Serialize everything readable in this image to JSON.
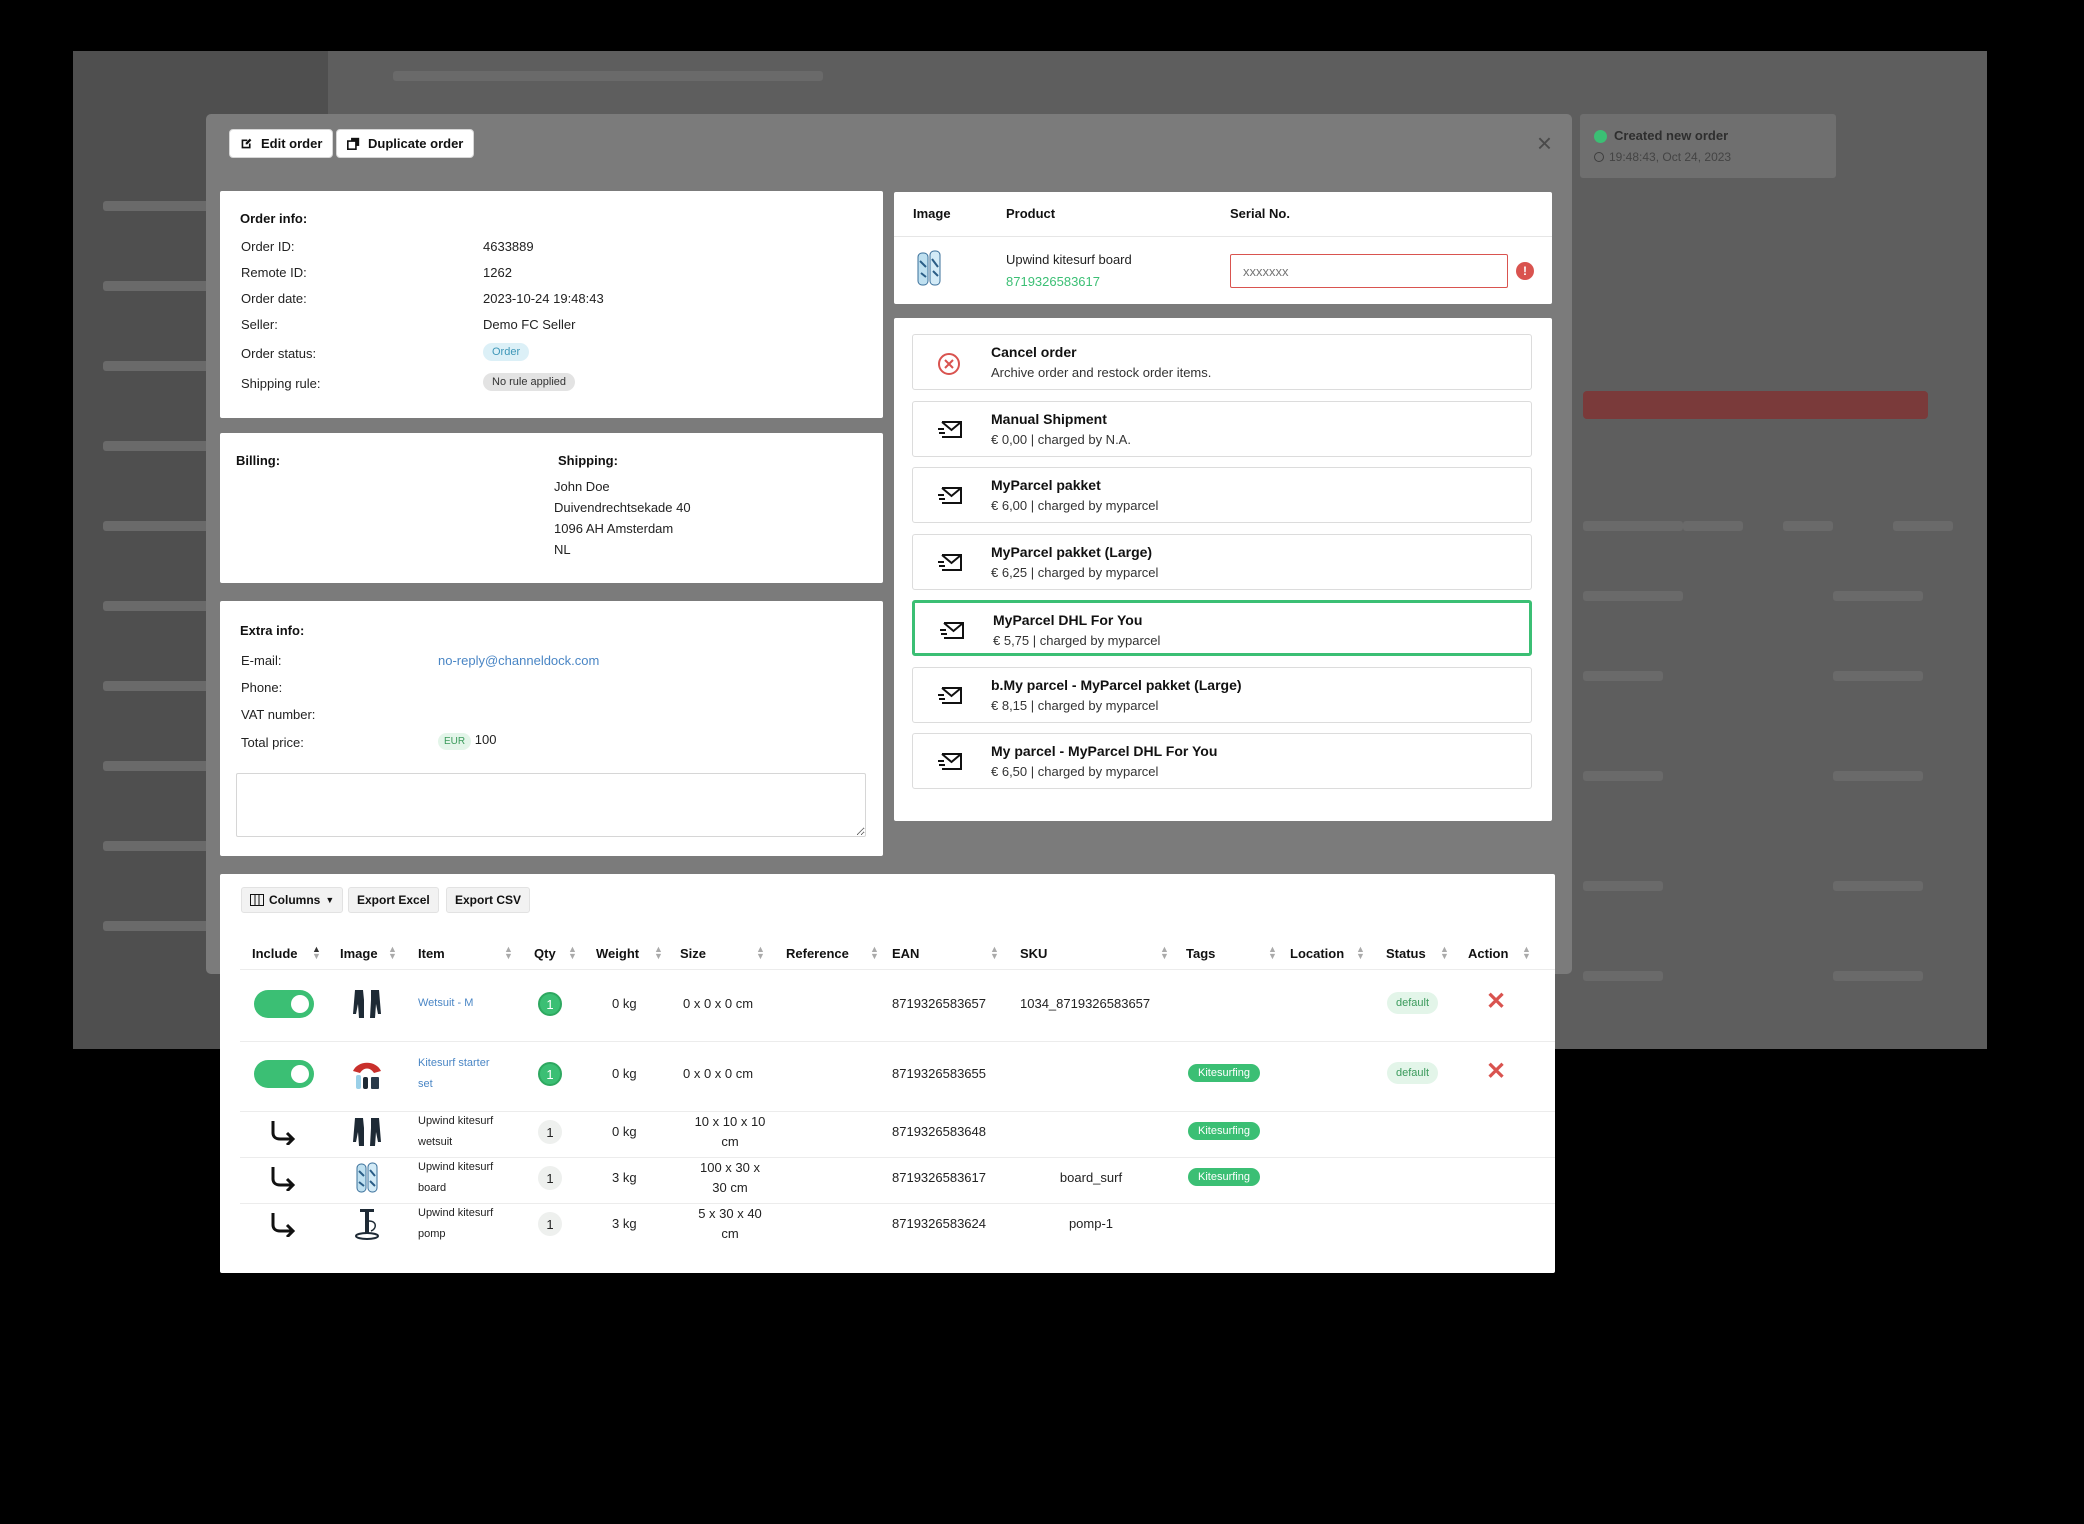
{
  "modal": {
    "edit_label": "Edit order",
    "duplicate_label": "Duplicate order",
    "close": "×"
  },
  "toast": {
    "title": "Created new order",
    "time": "19:48:43, Oct 24, 2023"
  },
  "order_info": {
    "heading": "Order info:",
    "rows": [
      {
        "label": "Order ID:",
        "value": "4633889"
      },
      {
        "label": "Remote ID:",
        "value": "1262"
      },
      {
        "label": "Order date:",
        "value": "2023-10-24 19:48:43"
      },
      {
        "label": "Seller:",
        "value": "Demo FC Seller"
      }
    ],
    "status_label": "Order status:",
    "status_badge": "Order",
    "rule_label": "Shipping rule:",
    "rule_badge": "No rule applied"
  },
  "address": {
    "billing_heading": "Billing:",
    "shipping_heading": "Shipping:",
    "shipping_lines": [
      "John Doe",
      "Duivendrechtsekade 40",
      "1096 AH Amsterdam",
      "NL"
    ]
  },
  "extra_info": {
    "heading": "Extra info:",
    "email_label": "E-mail:",
    "email": "no-reply@channeldock.com",
    "phone_label": "Phone:",
    "vat_label": "VAT number:",
    "total_label": "Total price:",
    "currency": "EUR",
    "total": "100"
  },
  "serial_table": {
    "headers": [
      "Image",
      "Product",
      "Serial No."
    ],
    "product_name": "Upwind kitesurf board",
    "product_ean": "8719326583617",
    "serial_placeholder": "xxxxxxx"
  },
  "shipping_options": [
    {
      "title": "Cancel order",
      "sub": "Archive order and restock order items.",
      "icon": "cancel-circle-icon",
      "selected": false
    },
    {
      "title": "Manual Shipment",
      "sub": "€ 0,00 | charged by N.A.",
      "icon": "envelope-icon",
      "selected": false
    },
    {
      "title": "MyParcel pakket",
      "sub": "€ 6,00 | charged by myparcel",
      "icon": "envelope-icon",
      "selected": false
    },
    {
      "title": "MyParcel pakket (Large)",
      "sub": "€ 6,25 | charged by myparcel",
      "icon": "envelope-icon",
      "selected": false
    },
    {
      "title": "MyParcel DHL For You",
      "sub": "€ 5,75 | charged by myparcel",
      "icon": "envelope-icon",
      "selected": true
    },
    {
      "title": "b.My parcel - MyParcel pakket (Large)",
      "sub": "€ 8,15 | charged by myparcel",
      "icon": "envelope-icon",
      "selected": false
    },
    {
      "title": "My parcel - MyParcel DHL For You",
      "sub": "€ 6,50 | charged by myparcel",
      "icon": "envelope-icon",
      "selected": false
    }
  ],
  "items_toolbar": {
    "columns": "Columns",
    "export_excel": "Export Excel",
    "export_csv": "Export CSV"
  },
  "items_headers": [
    "Include",
    "Image",
    "Item",
    "Qty",
    "Weight",
    "Size",
    "Reference",
    "EAN",
    "SKU",
    "Tags",
    "Location",
    "Status",
    "Action"
  ],
  "items": [
    {
      "item_a": "Wetsuit - M",
      "item_b": "",
      "qty": "1",
      "weight": "0 kg",
      "size_a": "0 x 0 x 0 cm",
      "size_b": "",
      "ean": "8719326583657",
      "sku": "1034_8719326583657",
      "tag": "",
      "status": "default",
      "child": false,
      "image": "wetsuit-image"
    },
    {
      "item_a": "Kitesurf starter",
      "item_b": "set",
      "qty": "1",
      "weight": "0 kg",
      "size_a": "0 x 0 x 0 cm",
      "size_b": "",
      "ean": "8719326583655",
      "sku": "",
      "tag": "Kitesurfing",
      "status": "default",
      "child": false,
      "image": "kite-set-image"
    },
    {
      "item_a": "Upwind kitesurf",
      "item_b": "wetsuit",
      "qty": "1",
      "weight": "0 kg",
      "size_a": "10 x 10 x 10",
      "size_b": "cm",
      "ean": "8719326583648",
      "sku": "",
      "tag": "Kitesurfing",
      "status": "",
      "child": true,
      "image": "wetsuit-image"
    },
    {
      "item_a": "Upwind kitesurf",
      "item_b": "board",
      "qty": "1",
      "weight": "3 kg",
      "size_a": "100 x 30 x",
      "size_b": "30 cm",
      "ean": "8719326583617",
      "sku": "board_surf",
      "tag": "Kitesurfing",
      "status": "",
      "child": true,
      "image": "board-image"
    },
    {
      "item_a": "Upwind kitesurf",
      "item_b": "pomp",
      "qty": "1",
      "weight": "3 kg",
      "size_a": "5 x 30 x 40",
      "size_b": "cm",
      "ean": "8719326583624",
      "sku": "pomp-1",
      "tag": "",
      "status": "",
      "child": true,
      "image": "pump-image"
    }
  ],
  "colors": {
    "accent": "#3bbf74",
    "danger": "#d9534f",
    "link": "#4a86c5"
  }
}
